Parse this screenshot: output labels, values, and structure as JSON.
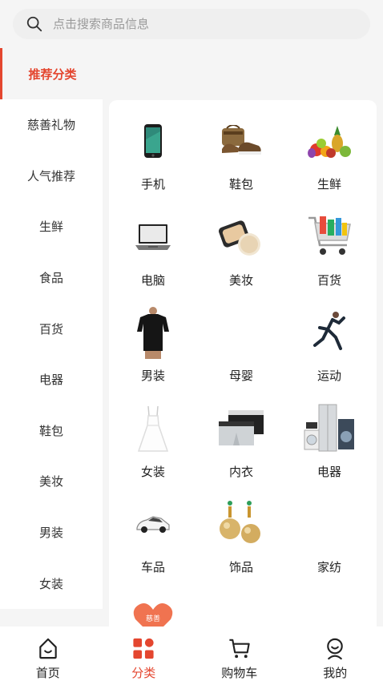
{
  "search": {
    "placeholder": "点击搜索商品信息"
  },
  "sidebar": {
    "items": [
      {
        "label": "推荐分类",
        "active": true
      },
      {
        "label": "慈善礼物"
      },
      {
        "label": "人气推荐"
      },
      {
        "label": "生鲜"
      },
      {
        "label": "食品"
      },
      {
        "label": "百货"
      },
      {
        "label": "电器"
      },
      {
        "label": "鞋包"
      },
      {
        "label": "美妆"
      },
      {
        "label": "男装"
      },
      {
        "label": "女装"
      }
    ]
  },
  "categories": [
    {
      "label": "手机",
      "icon": "phone-image"
    },
    {
      "label": "鞋包",
      "icon": "shoes-bag-image"
    },
    {
      "label": "生鲜",
      "icon": "fruit-image"
    },
    {
      "label": "电脑",
      "icon": "laptop-image"
    },
    {
      "label": "美妆",
      "icon": "cosmetics-image"
    },
    {
      "label": "百货",
      "icon": "shopping-cart-image"
    },
    {
      "label": "男装",
      "icon": "tshirt-image"
    },
    {
      "label": "母婴",
      "icon": ""
    },
    {
      "label": "运动",
      "icon": "runner-image"
    },
    {
      "label": "女装",
      "icon": "dress-image"
    },
    {
      "label": "内衣",
      "icon": "underwear-image"
    },
    {
      "label": "电器",
      "icon": "appliances-image"
    },
    {
      "label": "车品",
      "icon": "car-image"
    },
    {
      "label": "饰品",
      "icon": "earrings-image"
    },
    {
      "label": "家纺",
      "icon": ""
    },
    {
      "label": "",
      "icon": "charity-heart-image",
      "badge": "慈善"
    }
  ],
  "tabbar": {
    "items": [
      {
        "label": "首页",
        "icon": "home-icon"
      },
      {
        "label": "分类",
        "icon": "category-icon",
        "active": true
      },
      {
        "label": "购物车",
        "icon": "cart-icon"
      },
      {
        "label": "我的",
        "icon": "profile-icon"
      }
    ]
  },
  "colors": {
    "accent": "#e4462f",
    "background": "#f5f5f5"
  }
}
